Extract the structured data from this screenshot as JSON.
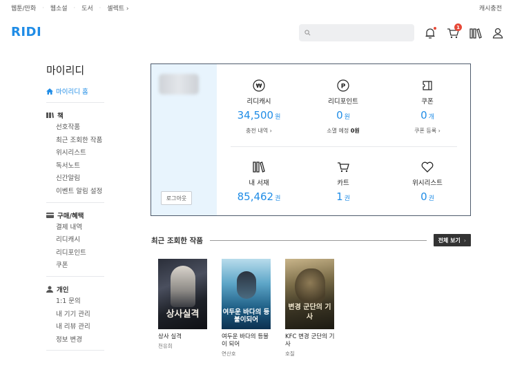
{
  "topnav": {
    "links": [
      "웹툰/만화",
      "웹소설",
      "도서",
      "셀렉트"
    ],
    "select_arrow": "›",
    "cash_charge": "캐시충전"
  },
  "header": {
    "logo": "RIDI",
    "search_placeholder": "",
    "icons": [
      "bell-icon",
      "cart-icon",
      "library-icon",
      "user-icon"
    ],
    "cart_badge": "1",
    "accent_color": "#1f8ce6"
  },
  "sidebar": {
    "title": "마이리디",
    "home": "마이리디 홈",
    "sections": [
      {
        "title": "책",
        "icon": "books-icon",
        "items": [
          "선호작품",
          "최근 조회한 작품",
          "위시리스트",
          "독서노트",
          "신간알림",
          "이벤트 알림 설정"
        ]
      },
      {
        "title": "구매/혜택",
        "icon": "card-icon",
        "items": [
          "결제 내역",
          "리디캐시",
          "리디포인트",
          "쿠폰"
        ]
      },
      {
        "title": "개인",
        "icon": "person-icon",
        "items": [
          "1:1 문의",
          "내 기기 관리",
          "내 리뷰 관리",
          "정보 변경"
        ]
      }
    ]
  },
  "account": {
    "logout": "로그아웃",
    "cash": {
      "label": "리디캐시",
      "value": "34,500",
      "unit": "원",
      "sub": "충전 내역 ›"
    },
    "point": {
      "label": "리디포인트",
      "value": "0",
      "unit": "원",
      "sub": "소멸 예정",
      "sub_value": "0원"
    },
    "coupon": {
      "label": "쿠폰",
      "value": "0",
      "unit": "개",
      "sub": "쿠폰 등록 ›"
    },
    "library": {
      "label": "내 서재",
      "value": "85,462",
      "unit": "권"
    },
    "cart": {
      "label": "카트",
      "value": "1",
      "unit": "권"
    },
    "wishlist": {
      "label": "위시리스트",
      "value": "0",
      "unit": "권"
    }
  },
  "recent": {
    "title": "최근 조회한 작품",
    "view_all": "전체 보기",
    "view_all_arrow": "›",
    "books": [
      {
        "title": "상사 실격",
        "author": "천유희",
        "cover_text": "상사실격"
      },
      {
        "title": "여두운 바다의 등불이 되어",
        "author": "연산호",
        "cover_text": "여두운 바다의 등불이되어"
      },
      {
        "title": "KFC 변경 군단의 기사",
        "author": "호질",
        "cover_text": "변경 군단의 기사"
      }
    ]
  }
}
